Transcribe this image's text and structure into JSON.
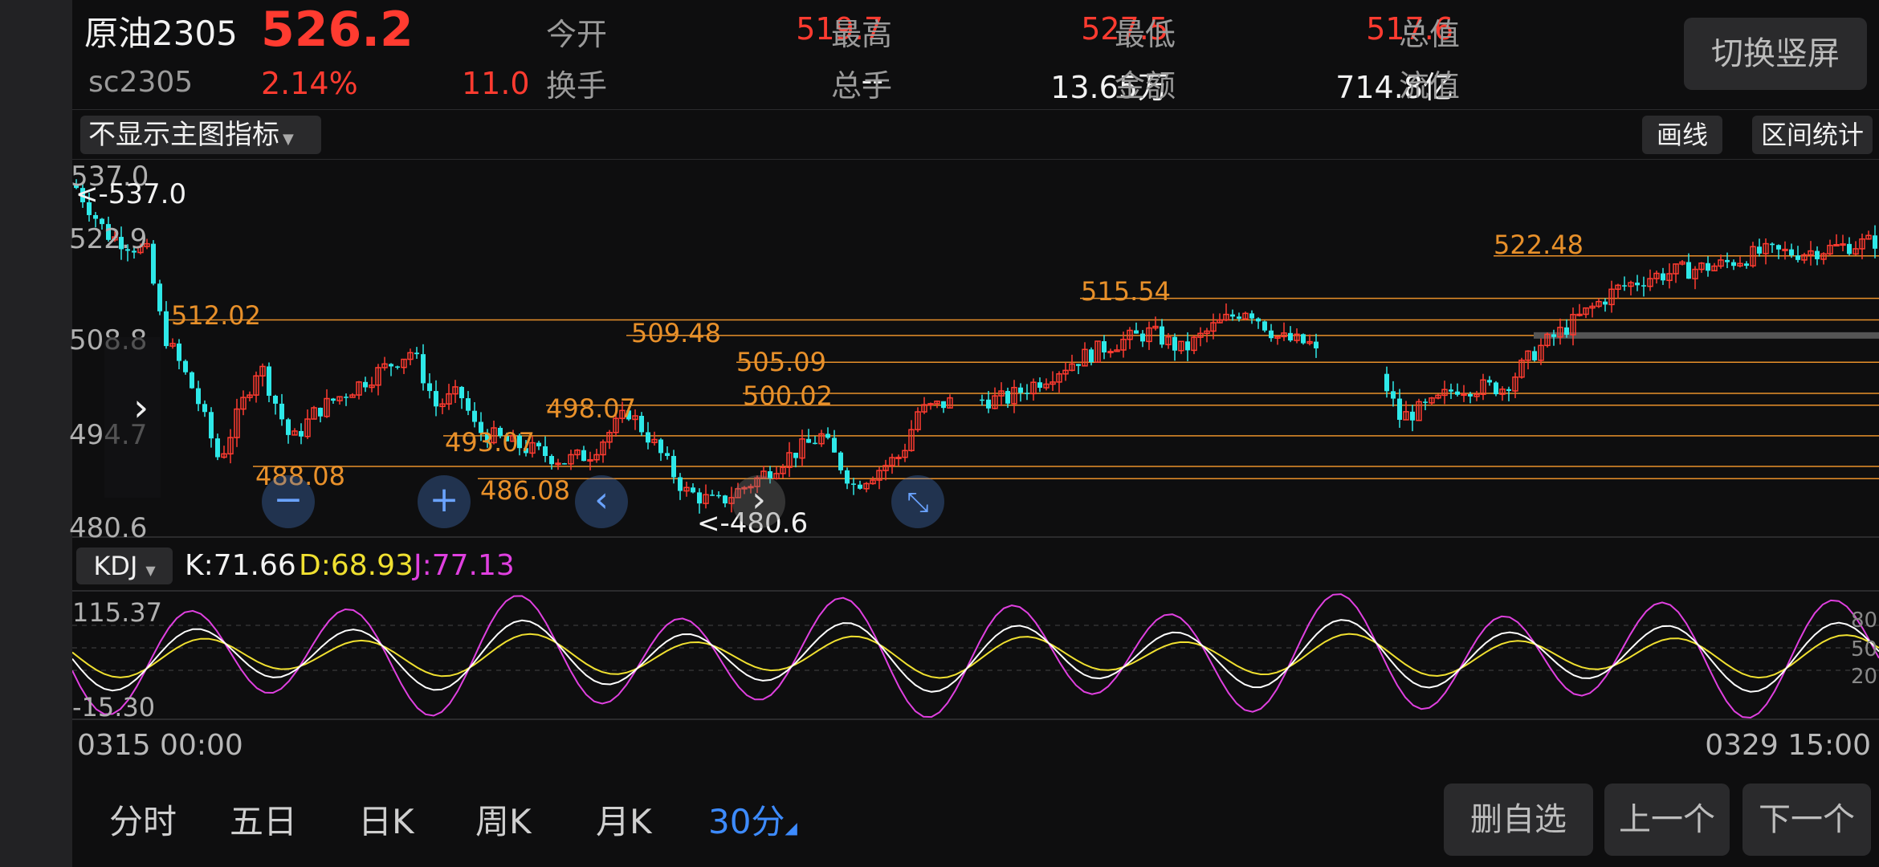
{
  "header": {
    "name": "原油2305",
    "code": "sc2305",
    "price": "526.2",
    "change_pct": "2.14%",
    "change": "11.0",
    "switch_label": "切换竖屏",
    "stats": [
      {
        "label": "今开",
        "value": "519.7",
        "color": "red"
      },
      {
        "label": "最高",
        "value": "527.5",
        "color": "red"
      },
      {
        "label": "最低",
        "value": "517.6",
        "color": "red"
      },
      {
        "label": "总值",
        "value": "--",
        "color": "white"
      },
      {
        "label": "换手",
        "value": "--",
        "color": "white"
      },
      {
        "label": "总手",
        "value": "13.65万",
        "color": "white"
      },
      {
        "label": "金额",
        "value": "714.8亿",
        "color": "white"
      },
      {
        "label": "流值",
        "value": "--",
        "color": "white"
      }
    ]
  },
  "toolbar": {
    "indicator_select": "不显示主图指标",
    "draw_button": "画线",
    "interval_button": "区间统计"
  },
  "main_chart": {
    "y_labels": [
      "537.0",
      "522.9",
      "508.8",
      "494.7",
      "480.6"
    ],
    "max_marker": "<-537.0",
    "min_marker": "<-480.6",
    "level_labels": [
      "512.02",
      "509.48",
      "505.09",
      "500.02",
      "498.07",
      "493.07",
      "488.08",
      "486.08",
      "515.54",
      "522.48"
    ]
  },
  "kdj": {
    "select": "KDJ",
    "k_label": "K:71.66",
    "d_label": "D:68.93",
    "j_label": "J:77.13",
    "top_value": "115.37",
    "bottom_value": "-15.30",
    "levels": [
      "80",
      "50",
      "20"
    ]
  },
  "time_axis": {
    "start": "0315 00:00",
    "end": "0329 15:00"
  },
  "tabs": [
    "分时",
    "五日",
    "日K",
    "周K",
    "月K",
    "30分"
  ],
  "active_tab": "30分",
  "actions": {
    "delete": "删自选",
    "prev": "上一个",
    "next": "下一个"
  },
  "colors": {
    "up": "#ff3b30",
    "down": "#2ee8e8",
    "level": "#e8902a",
    "k": "#ffffff",
    "d": "#f0e030",
    "j": "#e040e0",
    "active_tab": "#3d8bff"
  }
}
